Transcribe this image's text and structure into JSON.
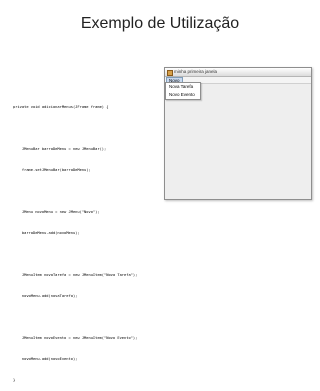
{
  "slide": {
    "title": "Exemplo de Utilização"
  },
  "code": {
    "lines": [
      "private void adicionarMenus(JFrame frame) {",
      "",
      "    JMenuBar barraDeMenu = new JMenuBar();",
      "    frame.setJMenuBar(barraDeMenu);",
      "",
      "    JMenu novoMenu = new JMenu(\"Novo\");",
      "    barraDeMenu.add(novoMenu);",
      "",
      "    JMenuItem novaTarefa = new JMenuItem(\"Nova Tarefa\");",
      "    novoMenu.add(novaTarefa);",
      "",
      "    JMenuItem novoEvento = new JMenuItem(\"Novo Evento\");",
      "    novoMenu.add(novoEvento);",
      "}"
    ]
  },
  "window": {
    "title": "minha primeira janela",
    "menu_label": "Novo",
    "menu_items": [
      "Nova Tarefa",
      "Novo Evento"
    ]
  }
}
